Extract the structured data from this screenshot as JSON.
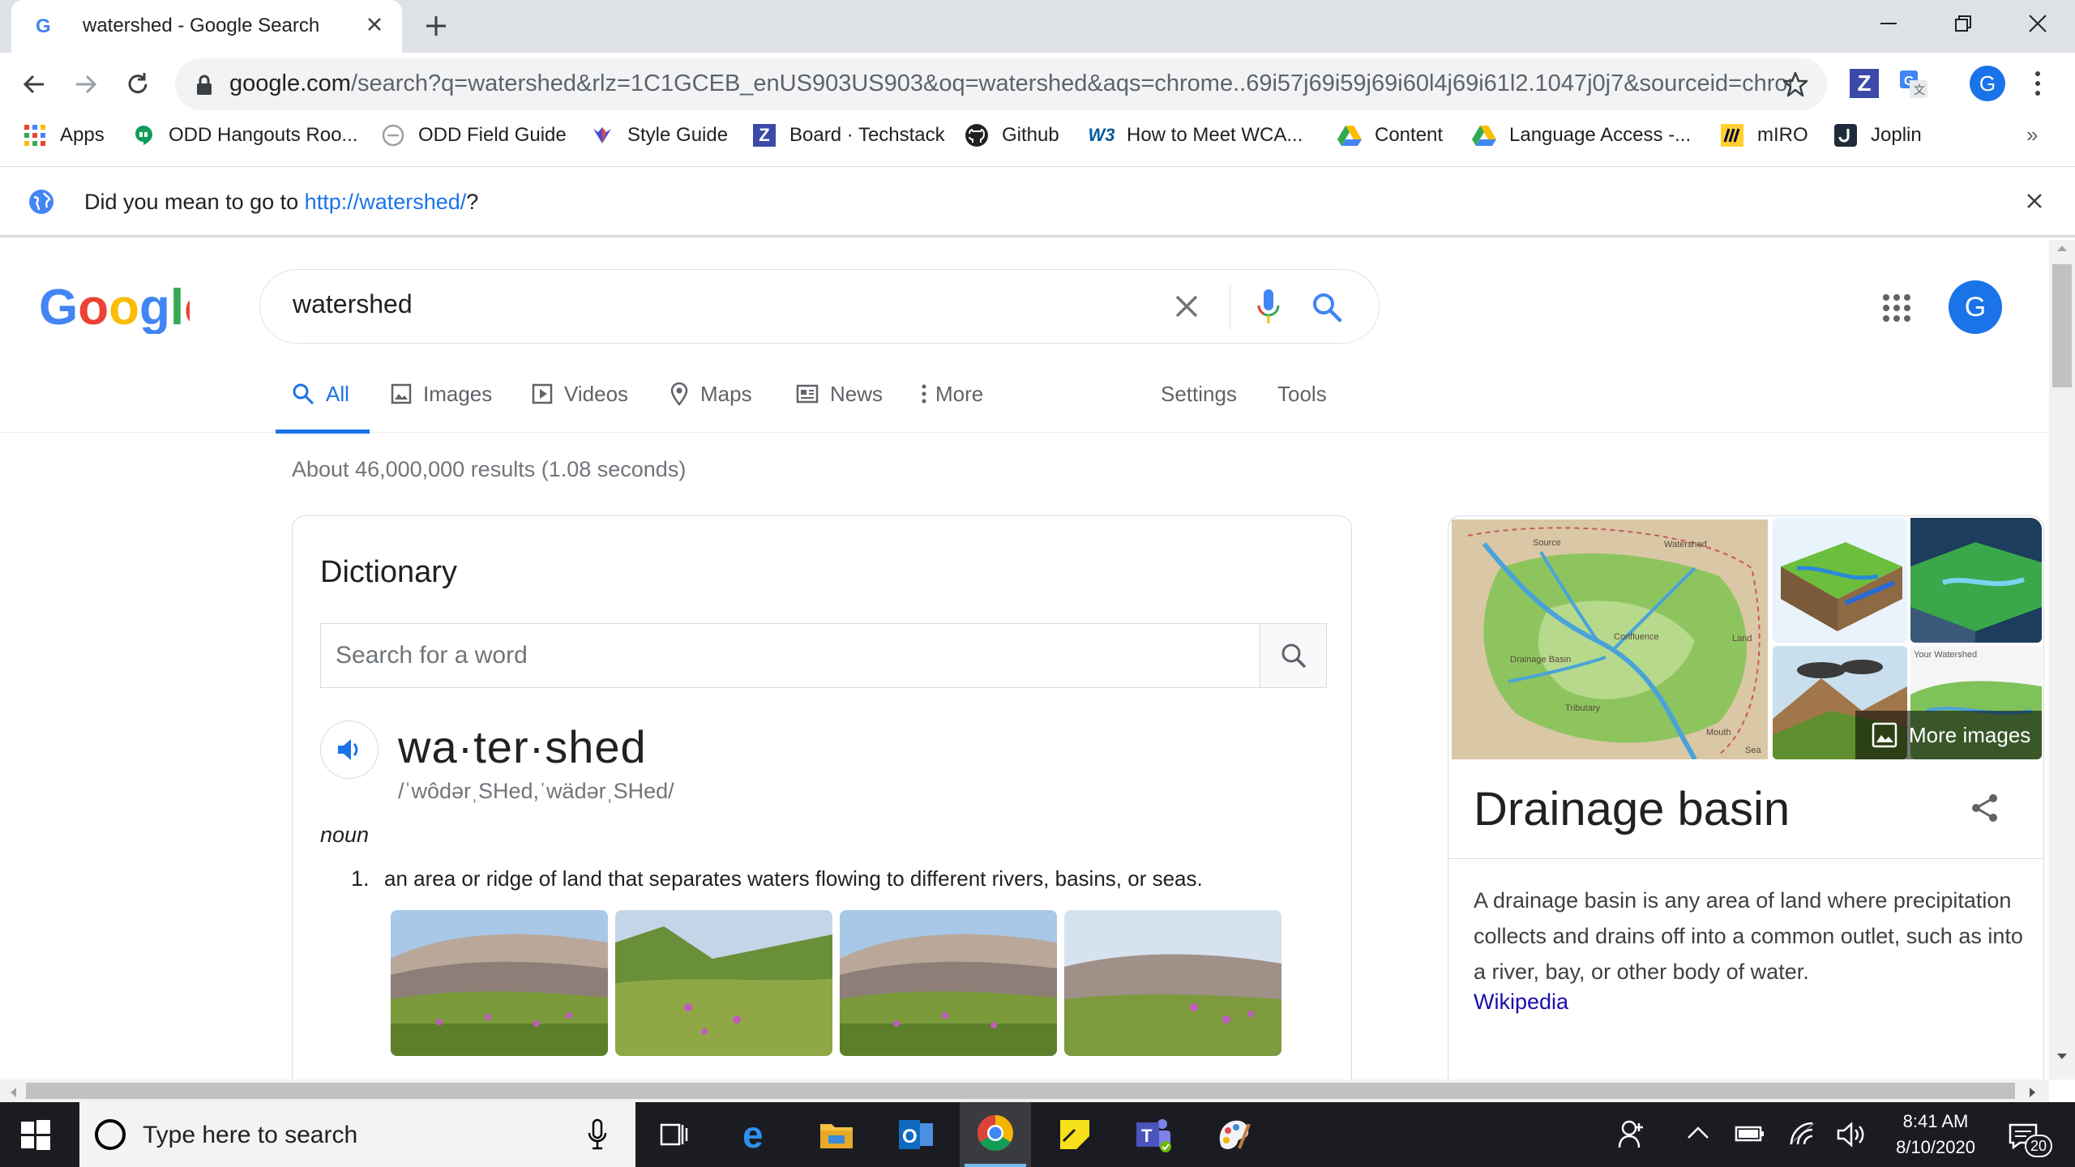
{
  "browser": {
    "tab_title": "watershed - Google Search",
    "url_host": "google.com",
    "url_rest": "/search?q=watershed&rlz=1C1GCEB_enUS903US903&oq=watershed&aqs=chrome..69i57j69i59j69i60l4j69i61l2.1047j0j7&sourceid=chrom...",
    "profile_initial": "G"
  },
  "bookmarks": [
    {
      "label": "Apps",
      "icon": "apps-grid-icon"
    },
    {
      "label": "ODD Hangouts Roo...",
      "icon": "hangouts-icon"
    },
    {
      "label": "ODD Field Guide",
      "icon": "field-guide-icon"
    },
    {
      "label": "Style Guide",
      "icon": "style-guide-icon"
    },
    {
      "label": "Board · Techstack",
      "icon": "zenhub-icon"
    },
    {
      "label": "Github",
      "icon": "github-icon"
    },
    {
      "label": "How to Meet WCA...",
      "icon": "w3c-icon"
    },
    {
      "label": "Content",
      "icon": "drive-icon"
    },
    {
      "label": "Language Access -...",
      "icon": "drive-icon"
    },
    {
      "label": "mIRO",
      "icon": "miro-icon"
    },
    {
      "label": "Joplin",
      "icon": "joplin-icon"
    }
  ],
  "infobar": {
    "prefix": "Did you mean to go to ",
    "link": "http://watershed/",
    "suffix": "?"
  },
  "search": {
    "query": "watershed",
    "tabs": [
      "All",
      "Images",
      "Videos",
      "Maps",
      "News",
      "More"
    ],
    "settings": "Settings",
    "tools": "Tools",
    "results_stats": "About 46,000,000 results (1.08 seconds)",
    "apps_initial": "G"
  },
  "dictionary": {
    "title": "Dictionary",
    "search_placeholder": "Search for a word",
    "word": "wa·ter·shed",
    "phonetic": "/ˈwôdərˌSHed,ˈwädərˌSHed/",
    "part_of_speech": "noun",
    "definition_number": "1.",
    "definition": "an area or ridge of land that separates waters flowing to different rivers, basins, or seas."
  },
  "knowledge_panel": {
    "title": "Drainage basin",
    "more_images": "More images",
    "description": "A drainage basin is any area of land where precipitation collects and drains off into a common outlet, such as into a river, bay, or other body of water.",
    "source": "Wikipedia",
    "map_labels": [
      "Source",
      "Watershed",
      "Confluence",
      "Land",
      "Drainage Basin",
      "Tributary",
      "Mouth",
      "Sea"
    ],
    "thumb_captions": [
      "Your Watershed"
    ]
  },
  "taskbar": {
    "search_placeholder": "Type here to search",
    "time": "8:41 AM",
    "date": "8/10/2020",
    "notification_count": "20"
  }
}
